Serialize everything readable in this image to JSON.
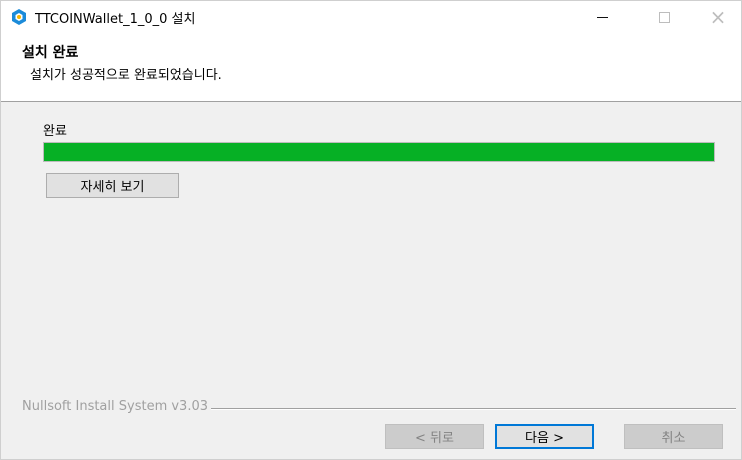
{
  "window": {
    "title": "TTCOINWallet_1_0_0 설치",
    "icon": "app-logo-icon",
    "controls": {
      "minimize": "minimize-icon",
      "maximize": "maximize-icon",
      "close": "×"
    }
  },
  "header": {
    "title": "설치 완료",
    "subtitle": "설치가 성공적으로 완료되었습니다."
  },
  "main": {
    "status_label": "완료",
    "progress_fraction": 1.0,
    "details_button": "자세히 보기"
  },
  "footer": {
    "branding": "Nullsoft Install System v3.03",
    "back_button": "< 뒤로",
    "next_button": "다음 >",
    "cancel_button": "취소"
  },
  "colors": {
    "progress": "#06b025",
    "focus_border": "#0078d7",
    "icon_primary": "#1b8bd9",
    "icon_secondary": "#f5b700"
  }
}
